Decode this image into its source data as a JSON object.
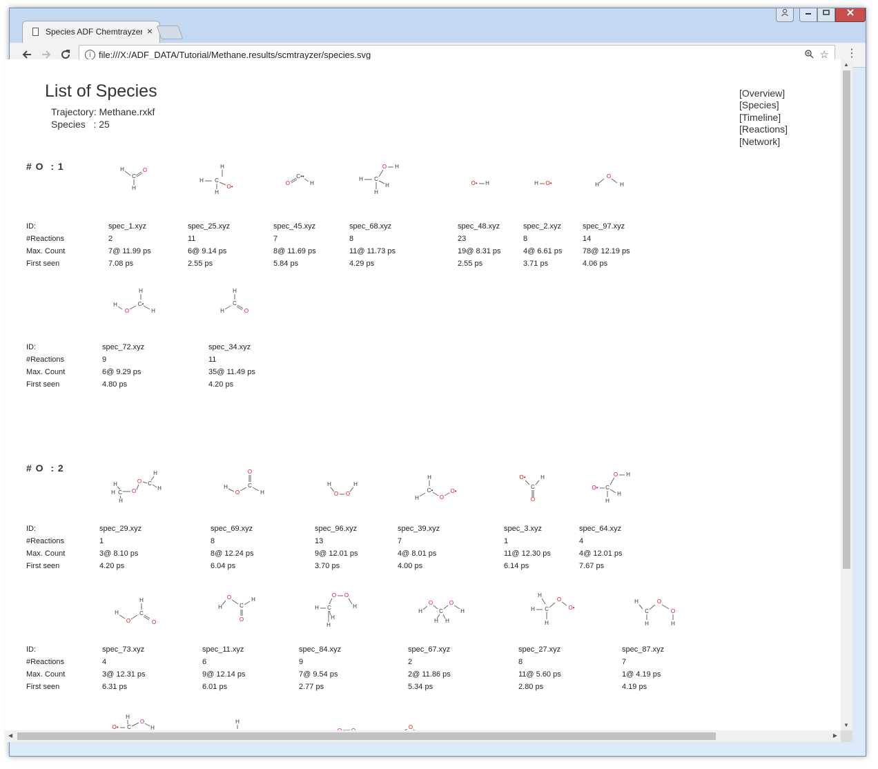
{
  "browser": {
    "tab_title": "Species ADF Chemtrayzer",
    "tab_close": "×",
    "url": "file:///X:/ADF_DATA/Tutorial/Methane.results/scmtrayzer/species.svg",
    "info_icon": "info-icon",
    "back_icon": "back-arrow-icon",
    "forward_icon": "forward-arrow-icon",
    "reload_icon": "reload-icon",
    "zoom_icon": "zoom-icon",
    "star_icon": "star-icon",
    "menu_icon": "menu-dots-icon"
  },
  "page": {
    "title": "List of Species",
    "trajectory": "Trajectory: Methane.rxkf",
    "species_count": "Species   : 25",
    "nav": [
      "[Overview]",
      "[Species]",
      "[Timeline]",
      "[Reactions]",
      "[Network]"
    ]
  },
  "row_labels": [
    "ID:",
    "#Reactions",
    "Max. Count",
    "First seen"
  ],
  "groups": [
    {
      "title": "# O  : 1",
      "rows": [
        [
          {
            "id": "spec_1.xyz",
            "reactions": "2",
            "max_count": "7@ 11.99 ps",
            "first_seen": "7.08 ps"
          },
          {
            "id": "spec_25.xyz",
            "reactions": "11",
            "max_count": "6@ 9.14 ps",
            "first_seen": "2.55 ps"
          },
          {
            "id": "spec_45.xyz",
            "reactions": "7",
            "max_count": "8@ 11.69 ps",
            "first_seen": "5.84 ps"
          },
          {
            "id": "spec_68.xyz",
            "reactions": "8",
            "max_count": "11@ 11.73 ps",
            "first_seen": "4.29 ps"
          },
          {
            "id": "spec_48.xyz",
            "reactions": "23",
            "max_count": "19@ 8.31 ps",
            "first_seen": "2.55 ps"
          },
          {
            "id": "spec_2.xyz",
            "reactions": "8",
            "max_count": "4@ 6.61 ps",
            "first_seen": "3.71 ps"
          },
          {
            "id": "spec_97.xyz",
            "reactions": "14",
            "max_count": "78@ 12.19 ps",
            "first_seen": "4.06 ps"
          }
        ],
        [
          {
            "id": "spec_72.xyz",
            "reactions": "9",
            "max_count": "6@ 9.29 ps",
            "first_seen": "4.80 ps"
          },
          {
            "id": "spec_34.xyz",
            "reactions": "11",
            "max_count": "35@ 11.49 ps",
            "first_seen": "4.20 ps"
          }
        ]
      ]
    },
    {
      "title": "# O  : 2",
      "rows": [
        [
          {
            "id": "spec_29.xyz",
            "reactions": "1",
            "max_count": "3@ 8.10 ps",
            "first_seen": "4.20 ps"
          },
          {
            "id": "spec_69.xyz",
            "reactions": "8",
            "max_count": "8@ 12.24 ps",
            "first_seen": "6.04 ps"
          },
          {
            "id": "spec_96.xyz",
            "reactions": "13",
            "max_count": "9@ 12.01 ps",
            "first_seen": "3.70 ps"
          },
          {
            "id": "spec_39.xyz",
            "reactions": "7",
            "max_count": "4@ 8.01 ps",
            "first_seen": "4.00 ps"
          },
          {
            "id": "spec_3.xyz",
            "reactions": "1",
            "max_count": "11@ 12.30 ps",
            "first_seen": "6.14 ps"
          },
          {
            "id": "spec_64.xyz",
            "reactions": "4",
            "max_count": "4@ 12.01 ps",
            "first_seen": "7.67 ps"
          }
        ],
        [
          {
            "id": "spec_73.xyz",
            "reactions": "4",
            "max_count": "3@ 12.31 ps",
            "first_seen": "6.31 ps"
          },
          {
            "id": "spec_11.xyz",
            "reactions": "6",
            "max_count": "9@ 12.14 ps",
            "first_seen": "6.01 ps"
          },
          {
            "id": "spec_84.xyz",
            "reactions": "9",
            "max_count": "7@ 9.54 ps",
            "first_seen": "2.77 ps"
          },
          {
            "id": "spec_67.xyz",
            "reactions": "2",
            "max_count": "2@ 11.86 ps",
            "first_seen": "5.34 ps"
          },
          {
            "id": "spec_27.xyz",
            "reactions": "8",
            "max_count": "11@ 5.60 ps",
            "first_seen": "2.80 ps"
          },
          {
            "id": "spec_87.xyz",
            "reactions": "7",
            "max_count": "1@ 4.19 ps",
            "first_seen": "4.19 ps"
          }
        ]
      ]
    }
  ]
}
